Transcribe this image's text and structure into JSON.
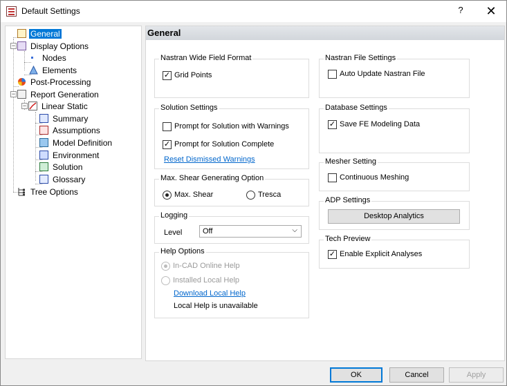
{
  "window": {
    "title": "Default Settings",
    "help_glyph": "?",
    "close_glyph": "✕"
  },
  "tree": {
    "items": [
      {
        "label": "General",
        "selected": true,
        "icon": "general-settings-icon"
      },
      {
        "label": "Display Options",
        "icon": "display-options-icon"
      },
      {
        "label": "Nodes",
        "icon": "node-dot-icon"
      },
      {
        "label": "Elements",
        "icon": "element-triangle-icon"
      },
      {
        "label": "Post-Processing",
        "icon": "post-processing-icon"
      },
      {
        "label": "Report Generation",
        "icon": "report-icon"
      },
      {
        "label": "Linear Static",
        "icon": "linear-static-icon"
      },
      {
        "label": "Summary",
        "icon": "summary-icon"
      },
      {
        "label": "Assumptions",
        "icon": "assumptions-icon"
      },
      {
        "label": "Model Definition",
        "icon": "model-definition-icon"
      },
      {
        "label": "Environment",
        "icon": "environment-icon"
      },
      {
        "label": "Solution",
        "icon": "solution-icon"
      },
      {
        "label": "Glossary",
        "icon": "glossary-icon"
      },
      {
        "label": "Tree Options",
        "icon": "tree-options-icon"
      }
    ],
    "expander_minus": "−"
  },
  "panel": {
    "header": "General",
    "nastran_wide": {
      "title": "Nastran Wide Field Format",
      "grid_points": "Grid Points",
      "grid_points_checked": true
    },
    "solution_settings": {
      "title": "Solution Settings",
      "prompt_warnings": "Prompt for Solution with Warnings",
      "prompt_warnings_checked": false,
      "prompt_complete": "Prompt for Solution Complete",
      "prompt_complete_checked": true,
      "reset_link": "Reset Dismissed Warnings"
    },
    "max_shear": {
      "title": "Max. Shear Generating Option",
      "opt1": "Max. Shear",
      "opt2": "Tresca",
      "selected": "Max. Shear"
    },
    "logging": {
      "title": "Logging",
      "level_label": "Level",
      "level_value": "Off"
    },
    "help_options": {
      "title": "Help Options",
      "opt1": "In-CAD Online Help",
      "opt2": "Installed Local Help",
      "download_link": "Download Local Help",
      "status": "Local Help is unavailable"
    },
    "nastran_file": {
      "title": "Nastran File Settings",
      "auto_update": "Auto Update Nastran File",
      "auto_update_checked": false
    },
    "database": {
      "title": "Database Settings",
      "save_fe": "Save FE Modeling Data",
      "save_fe_checked": true
    },
    "mesher": {
      "title": "Mesher Setting",
      "continuous": "Continuous Meshing",
      "continuous_checked": false
    },
    "adp": {
      "title": "ADP Settings",
      "button": "Desktop Analytics"
    },
    "tech_preview": {
      "title": "Tech Preview",
      "explicit": "Enable Explicit Analyses",
      "explicit_checked": true
    }
  },
  "footer": {
    "ok": "OK",
    "cancel": "Cancel",
    "apply": "Apply"
  },
  "checkmark": "✓",
  "dropdown_arrow": "⌵"
}
